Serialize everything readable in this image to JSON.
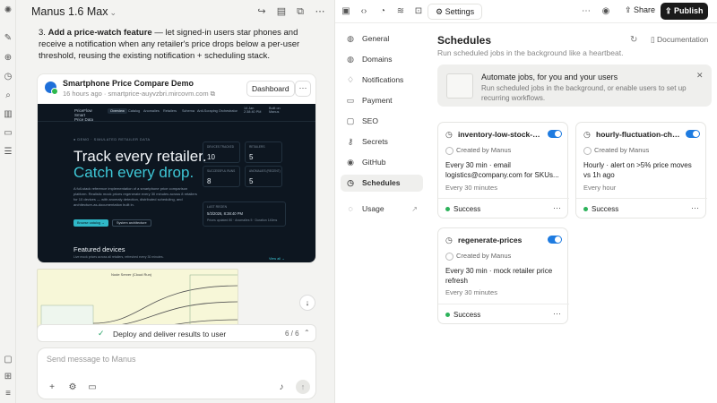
{
  "app": {
    "title": "Manus 1.6 Max"
  },
  "rail": {
    "icons": [
      "manus-logo-icon",
      "edit-icon",
      "compass-icon",
      "clock-icon",
      "search-icon",
      "library-icon",
      "folder-icon",
      "tasks-icon",
      "chat-icon",
      "apps-icon",
      "sliders-icon"
    ]
  },
  "message": {
    "number": "3.",
    "bold": "Add a price-watch feature",
    "text": " — let signed-in users star phones and receive a notification when any retailer's price drops below a per-user threshold, reusing the existing notification + scheduling stack."
  },
  "card": {
    "title": "Smartphone Price Compare Demo",
    "time": "16 hours ago",
    "url": "smartprice-auyvzbri.mircovm.com",
    "dashboard_label": "Dashboard",
    "more": "···"
  },
  "preview": {
    "logo": "PriceFlow\nSmart\nPrice Data",
    "tabs": [
      "Overview",
      "Catalog",
      "Anomalies",
      "Retailers",
      "Schema",
      "Anti-Scraping Orchestrator",
      "14 Jan\n2:38:40 PM",
      "Built on\nManus"
    ],
    "eyebrow": "● DEMO · SIMULATED RETAILER DATA",
    "h1": "Track every retailer.",
    "h1b": "Catch every drop.",
    "para": "A full-stack reference implementation of a smartphone price comparison platform. Realistic mock prices regenerate every 30 minutes across 8 retailers for 10 devices — with anomaly detection, distributed scheduling, and architecture-as-documentation built in.",
    "btn1": "Browse catalog →",
    "btn2": "System architecture",
    "stats": [
      {
        "label": "DEVICES TRACKED",
        "value": "10"
      },
      {
        "label": "RETAILERS",
        "value": "5"
      },
      {
        "label": "SUCCESSFUL RUNS",
        "value": "8"
      },
      {
        "label": "ANOMALIES (RECENT)",
        "value": "5"
      }
    ],
    "last_label": "LAST REGEN",
    "last_value": "5/3/2026, 8:38:40 PM",
    "last_sub": "Prices updated 80 · Anomalies 5 · Duration 140ms",
    "featured": "Featured devices",
    "featured_sub": "Live mock prices across all retailers, refreshed every 30 minutes.",
    "view_all": "View all →"
  },
  "thumb": {
    "title": "Node Server (Cloud Run)"
  },
  "task": {
    "label": "Deploy and deliver results to user",
    "count": "6 / 6"
  },
  "composer": {
    "placeholder": "Send message to Manus"
  },
  "right_toolbar": {
    "settings_label": "Settings",
    "share_label": "Share",
    "publish_label": "Publish"
  },
  "settings_nav": [
    {
      "label": "General",
      "icon": "globe-icon"
    },
    {
      "label": "Domains",
      "icon": "globe-icon"
    },
    {
      "label": "Notifications",
      "icon": "bell-icon"
    },
    {
      "label": "Payment",
      "icon": "card-icon"
    },
    {
      "label": "SEO",
      "icon": "seo-icon"
    },
    {
      "label": "Secrets",
      "icon": "key-icon"
    },
    {
      "label": "GitHub",
      "icon": "github-icon"
    },
    {
      "label": "Schedules",
      "icon": "clock-icon",
      "active": true
    },
    {
      "label": "Usage",
      "icon": "usage-icon"
    }
  ],
  "schedules": {
    "title": "Schedules",
    "subtitle": "Run scheduled jobs in the background like a heartbeat.",
    "docs_label": "Documentation",
    "banner_title": "Automate jobs, for you and your users",
    "banner_desc": "Run scheduled jobs in the background, or enable users to set up recurring workflows.",
    "jobs": [
      {
        "name": "inventory-low-stock-ch...",
        "creator": "Created by Manus",
        "desc": "Every 30 min · email logistics@company.com for SKUs...",
        "freq": "Every 30 minutes",
        "status": "Success",
        "enabled": true
      },
      {
        "name": "hourly-fluctuation-check",
        "creator": "Created by Manus",
        "desc": "Hourly · alert on >5% price moves vs 1h ago",
        "freq": "Every hour",
        "status": "Success",
        "enabled": true
      },
      {
        "name": "regenerate-prices",
        "creator": "Created by Manus",
        "desc": "Every 30 min · mock retailer price refresh",
        "freq": "Every 30 minutes",
        "status": "Success",
        "enabled": true
      }
    ]
  },
  "colors": {
    "accent": "#1e7be0",
    "success": "#2cb25a",
    "preview_bg": "#0d1620",
    "preview_accent": "#3ec7d6"
  }
}
